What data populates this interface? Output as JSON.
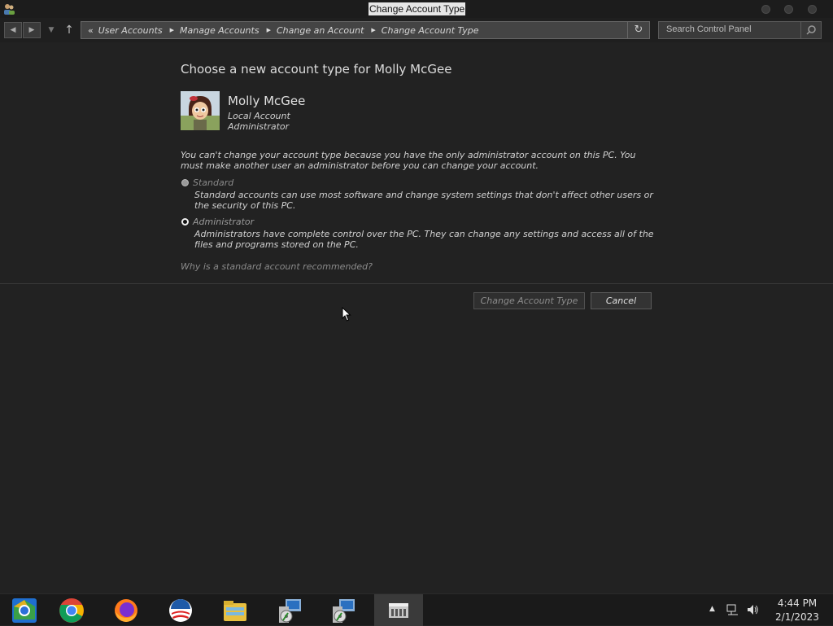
{
  "window": {
    "title": "Change Account Type"
  },
  "breadcrumb": {
    "overflow": "«",
    "items": [
      "User Accounts",
      "Manage Accounts",
      "Change an Account",
      "Change Account Type"
    ]
  },
  "search": {
    "placeholder": "Search Control Panel"
  },
  "main": {
    "heading": "Choose a new account type for Molly McGee",
    "user": {
      "name": "Molly McGee",
      "account_kind": "Local Account",
      "account_type": "Administrator"
    },
    "warning": "You can't change your account type because you have the only administrator account on this PC. You must make another user an administrator before you can change your account.",
    "options": [
      {
        "label": "Standard",
        "description": "Standard accounts can use most software and change system settings that don't affect other users or the security of this PC.",
        "selected": false,
        "disabled": true
      },
      {
        "label": "Administrator",
        "description": "Administrators have complete control over the PC. They can change any settings and access all of the files and programs stored on the PC.",
        "selected": true,
        "disabled": true
      }
    ],
    "help_link": "Why is a standard account recommended?",
    "buttons": {
      "change": "Change Account Type",
      "cancel": "Cancel"
    }
  },
  "taskbar": {
    "apps": [
      "chromium-icon",
      "chrome-icon",
      "firefox-icon",
      "obama-logo-icon",
      "file-explorer-icon",
      "setup-installer-icon",
      "setup-installer-icon",
      "control-panel-icon"
    ],
    "active_index": 7,
    "clock": {
      "time": "4:44 PM",
      "date": "2/1/2023"
    }
  },
  "colors": {
    "background": "#222222",
    "text": "#d8d8d8",
    "muted": "#8a8a8a"
  }
}
